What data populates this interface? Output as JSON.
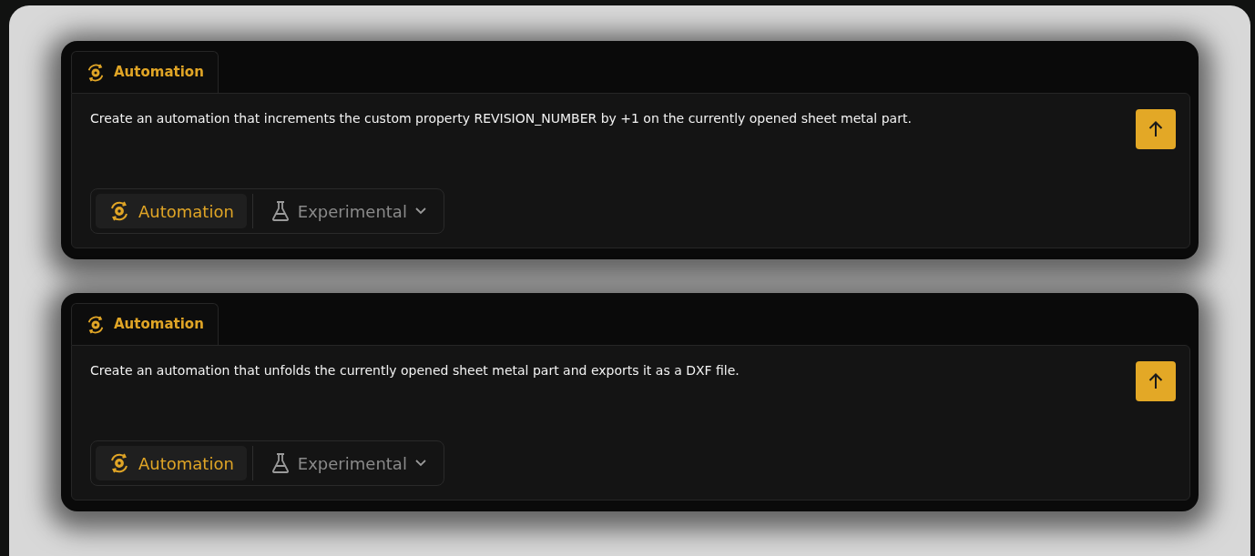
{
  "cards": [
    {
      "tab": {
        "label": "Automation",
        "selected": true
      },
      "prompt": "Create an automation that increments the custom property REVISION_NUMBER by +1 on the currently opened sheet metal part.",
      "modes": [
        {
          "kind": "automation",
          "label": "Automation",
          "selected": true
        },
        {
          "kind": "experimental",
          "label": "Experimental",
          "selected": false
        }
      ]
    },
    {
      "tab": {
        "label": "Automation",
        "selected": true
      },
      "prompt": "Create an automation that unfolds the currently opened sheet metal part and exports it as a DXF file.",
      "modes": [
        {
          "kind": "automation",
          "label": "Automation",
          "selected": true
        },
        {
          "kind": "experimental",
          "label": "Experimental",
          "selected": false
        }
      ]
    }
  ]
}
